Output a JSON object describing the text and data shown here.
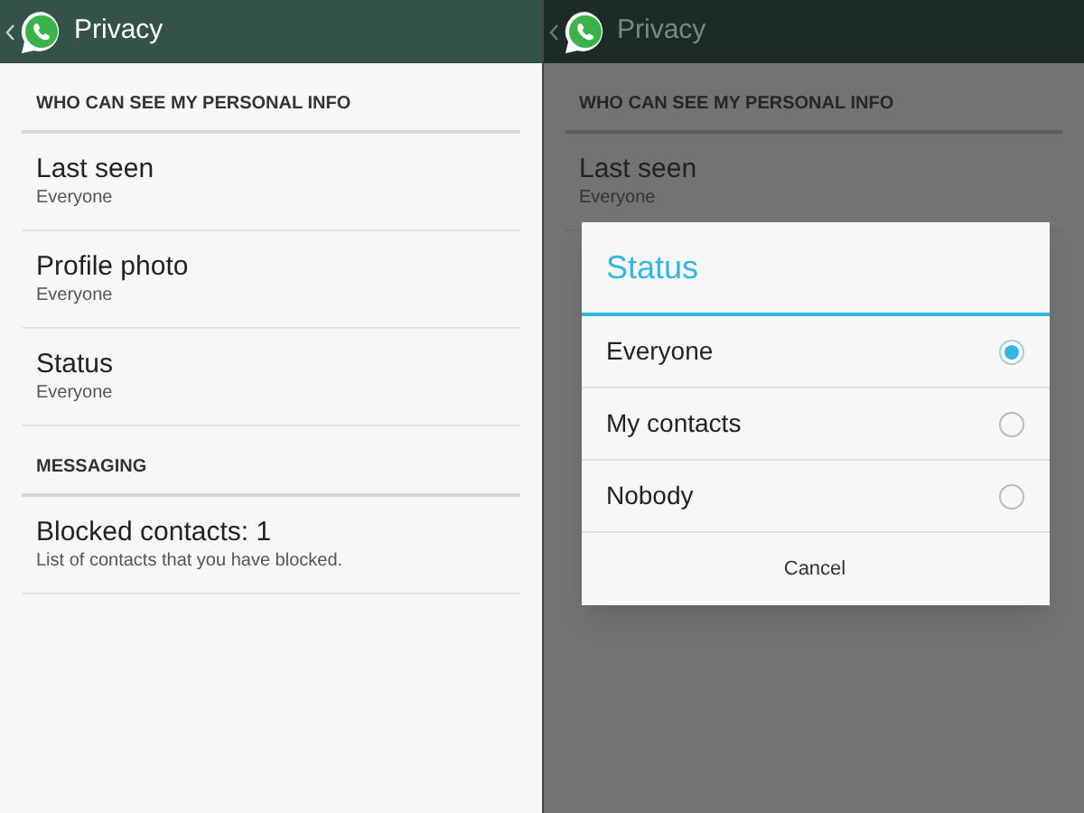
{
  "screens": [
    {
      "title": "Privacy",
      "dimmed": false,
      "sections": [
        {
          "header": "WHO CAN SEE MY PERSONAL INFO",
          "items": [
            {
              "title": "Last seen",
              "subtitle": "Everyone"
            },
            {
              "title": "Profile photo",
              "subtitle": "Everyone"
            },
            {
              "title": "Status",
              "subtitle": "Everyone"
            }
          ]
        },
        {
          "header": "MESSAGING",
          "items": [
            {
              "title": "Blocked contacts: 1",
              "subtitle": "List of contacts that you have blocked."
            }
          ]
        }
      ]
    },
    {
      "title": "Privacy",
      "dimmed": true,
      "sections": [
        {
          "header": "WHO CAN SEE MY PERSONAL INFO",
          "items": [
            {
              "title": "Last seen",
              "subtitle": "Everyone"
            }
          ]
        }
      ],
      "dialog": {
        "title": "Status",
        "options": [
          {
            "label": "Everyone",
            "selected": true
          },
          {
            "label": "My contacts",
            "selected": false
          },
          {
            "label": "Nobody",
            "selected": false
          }
        ],
        "button": "Cancel"
      }
    }
  ]
}
